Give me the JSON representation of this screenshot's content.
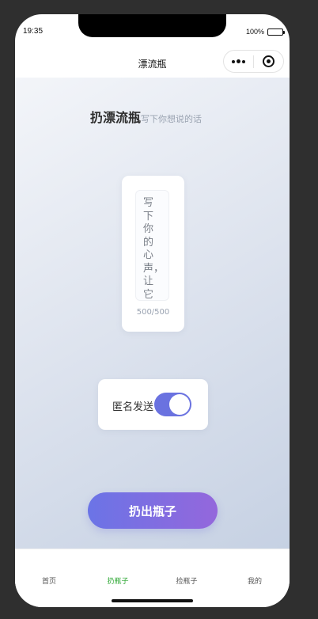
{
  "status": {
    "time": "19:35",
    "battery": "100%"
  },
  "navbar": {
    "title": "漂流瓶"
  },
  "page": {
    "title": "扔漂流瓶",
    "subtitle": "写下你想说的话"
  },
  "message": {
    "placeholder": "写下你的心声，让它随",
    "char_count": "500/500"
  },
  "anonymous": {
    "label": "匿名发送",
    "enabled": true
  },
  "actions": {
    "throw_label": "扔出瓶子"
  },
  "tabs": [
    {
      "label": "首页",
      "active": false
    },
    {
      "label": "扔瓶子",
      "active": true
    },
    {
      "label": "捡瓶子",
      "active": false
    },
    {
      "label": "我的",
      "active": false
    }
  ],
  "colors": {
    "accent": "#6a72e0",
    "button_start": "#6b74e6",
    "button_end": "#9467dc",
    "tab_active": "#2aa630"
  }
}
